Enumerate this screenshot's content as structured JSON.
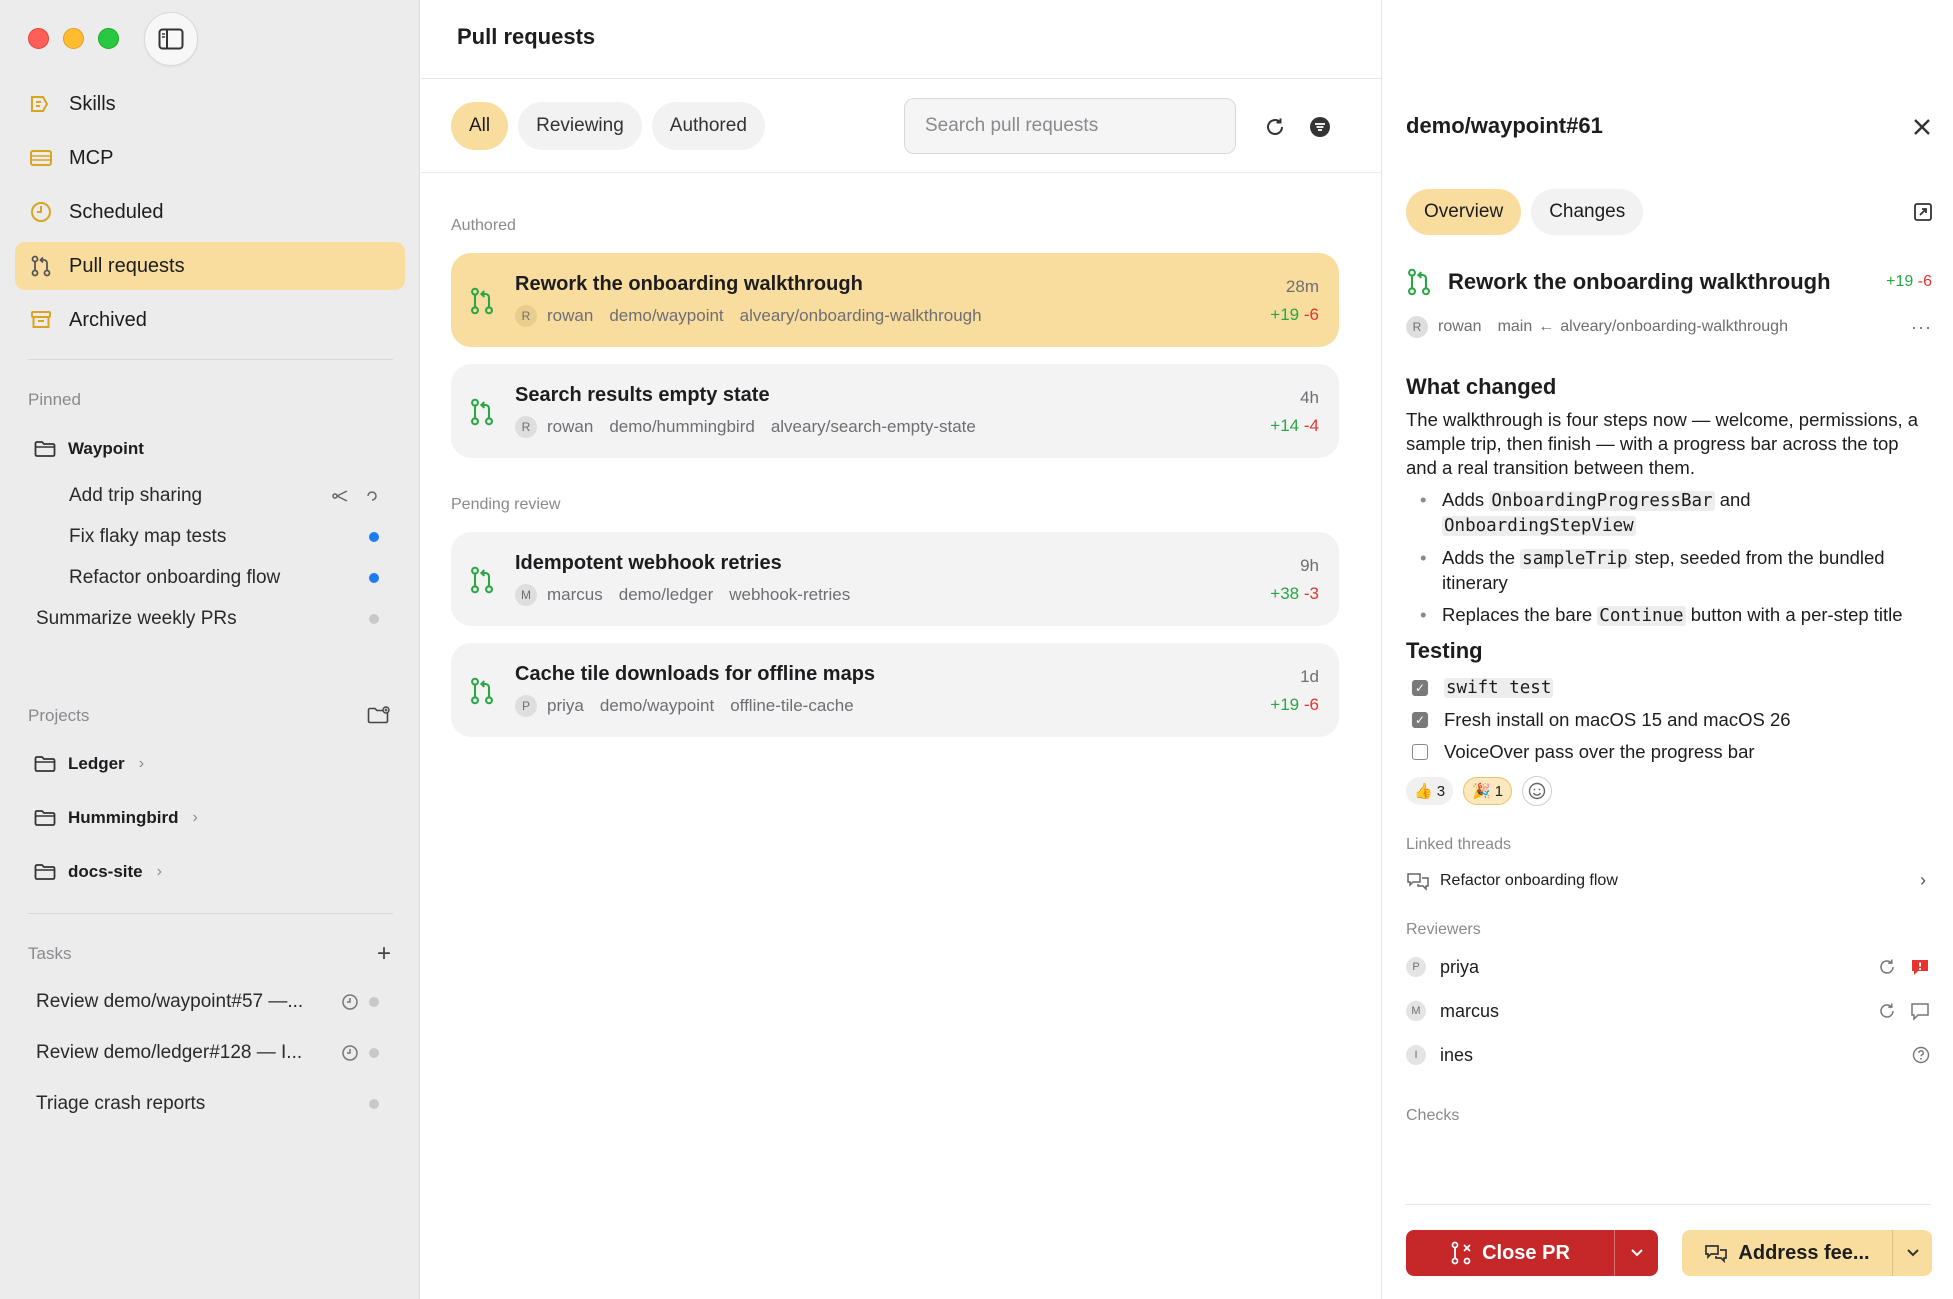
{
  "colors": {
    "accent": "#f8dd9e",
    "added": "#28a745",
    "removed": "#e5342f",
    "danger_button": "#c6282a",
    "unread_dot": "#1e7cf2"
  },
  "sidebar": {
    "nav": [
      {
        "label": "Skills",
        "icon": "skills-icon"
      },
      {
        "label": "MCP",
        "icon": "mcp-icon"
      },
      {
        "label": "Scheduled",
        "icon": "clock-icon"
      },
      {
        "label": "Pull requests",
        "icon": "pull-request-icon",
        "active": true
      },
      {
        "label": "Archived",
        "icon": "archive-icon"
      }
    ],
    "pinned": {
      "label": "Pinned",
      "folder": "Waypoint",
      "threads": [
        {
          "label": "Add trip sharing"
        },
        {
          "label": "Fix flaky map tests"
        },
        {
          "label": "Refactor onboarding flow"
        }
      ],
      "extra": "Summarize weekly PRs"
    },
    "projects": {
      "label": "Projects",
      "items": [
        "Ledger",
        "Hummingbird",
        "docs-site"
      ]
    },
    "tasks": {
      "label": "Tasks",
      "items": [
        "Review demo/waypoint#57 —...",
        "Review demo/ledger#128 — I...",
        "Triage crash reports"
      ]
    }
  },
  "main": {
    "title": "Pull requests",
    "filters": [
      "All",
      "Reviewing",
      "Authored"
    ],
    "active_filter": "All",
    "search_placeholder": "Search pull requests",
    "groups": [
      {
        "label": "Authored",
        "items": [
          {
            "title": "Rework the onboarding walkthrough",
            "author_initial": "R",
            "author": "rowan",
            "repo": "demo/waypoint",
            "branch": "alveary/onboarding-walkthrough",
            "time": "28m",
            "added": "+19",
            "removed": "-6",
            "selected": true
          },
          {
            "title": "Search results empty state",
            "author_initial": "R",
            "author": "rowan",
            "repo": "demo/hummingbird",
            "branch": "alveary/search-empty-state",
            "time": "4h",
            "added": "+14",
            "removed": "-4"
          }
        ]
      },
      {
        "label": "Pending review",
        "items": [
          {
            "title": "Idempotent webhook retries",
            "author_initial": "M",
            "author": "marcus",
            "repo": "demo/ledger",
            "branch": "webhook-retries",
            "time": "9h",
            "added": "+38",
            "removed": "-3"
          },
          {
            "title": "Cache tile downloads for offline maps",
            "author_initial": "P",
            "author": "priya",
            "repo": "demo/waypoint",
            "branch": "offline-tile-cache",
            "time": "1d",
            "added": "+19",
            "removed": "-6"
          }
        ]
      }
    ]
  },
  "detail": {
    "ref": "demo/waypoint#61",
    "tabs": [
      "Overview",
      "Changes"
    ],
    "active_tab": "Overview",
    "pr_title": "Rework the onboarding walkthrough",
    "added": "+19",
    "removed": "-6",
    "author_initial": "R",
    "author": "rowan",
    "base_branch": "main",
    "arrow": "←",
    "head_branch": "alveary/onboarding-walkthrough",
    "what_changed": {
      "heading": "What changed",
      "intro": "The walkthrough is four steps now — welcome, permissions, a sample trip, then finish — with a progress bar across the top and a real transition between them.",
      "b1_pre": "Adds ",
      "b1_code1": "OnboardingProgressBar",
      "b1_mid": " and ",
      "b1_code2": "OnboardingStepView",
      "b2_pre": "Adds the ",
      "b2_code": "sampleTrip",
      "b2_post": " step, seeded from the bundled itinerary",
      "b3_pre": "Replaces the bare ",
      "b3_code": "Continue",
      "b3_post": " button with a per-step title"
    },
    "testing": {
      "heading": "Testing",
      "items": [
        {
          "label": "swift test",
          "checked": true,
          "code": true
        },
        {
          "label": "Fresh install on macOS 15 and macOS 26",
          "checked": true
        },
        {
          "label": "VoiceOver pass over the progress bar",
          "checked": false
        }
      ]
    },
    "reactions": [
      {
        "emoji": "👍",
        "count": "3"
      },
      {
        "emoji": "🎉",
        "count": "1",
        "mine": true
      }
    ],
    "linked_label": "Linked threads",
    "linked_thread": "Refactor onboarding flow",
    "reviewers_label": "Reviewers",
    "reviewers": [
      {
        "initial": "P",
        "name": "priya",
        "status": "changes-requested"
      },
      {
        "initial": "M",
        "name": "marcus",
        "status": "commented"
      },
      {
        "initial": "I",
        "name": "ines",
        "status": "pending"
      }
    ],
    "checks_label": "Checks",
    "close_button": "Close PR",
    "address_button": "Address fee..."
  }
}
